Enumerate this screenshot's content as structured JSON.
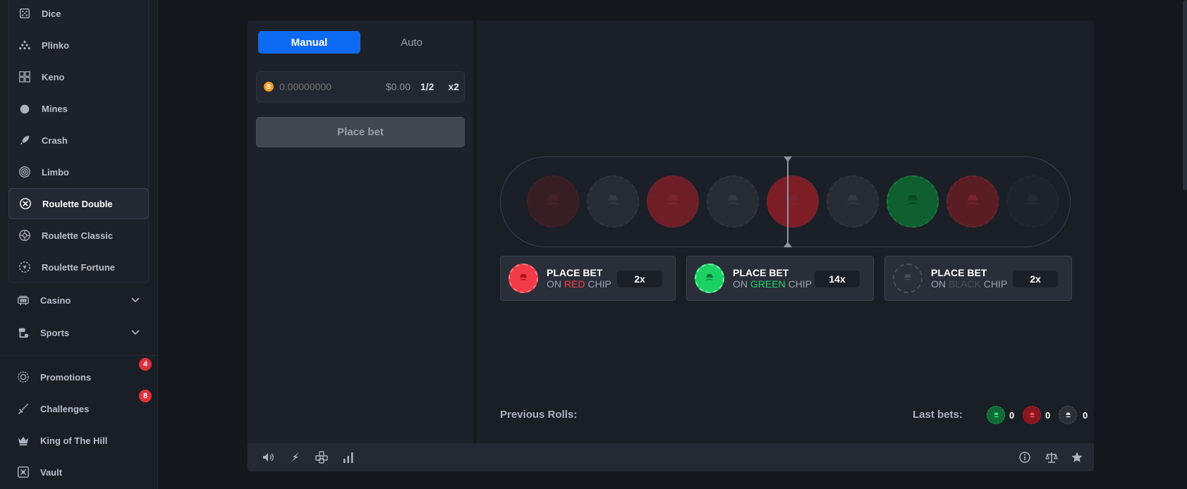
{
  "sidebar": {
    "games": [
      {
        "label": "Dice",
        "icon": "dice-icon"
      },
      {
        "label": "Plinko",
        "icon": "plinko-icon"
      },
      {
        "label": "Keno",
        "icon": "keno-icon"
      },
      {
        "label": "Mines",
        "icon": "mine-icon"
      },
      {
        "label": "Crash",
        "icon": "rocket-icon"
      },
      {
        "label": "Limbo",
        "icon": "target-icon"
      },
      {
        "label": "Roulette Double",
        "icon": "roulette-double-icon",
        "active": true
      },
      {
        "label": "Roulette Classic",
        "icon": "roulette-wheel-icon"
      },
      {
        "label": "Roulette Fortune",
        "icon": "roulette-fortune-icon"
      }
    ],
    "casino_label": "Casino",
    "sports_label": "Sports",
    "extras": [
      {
        "label": "Promotions",
        "icon": "promotions-icon",
        "badge": "4"
      },
      {
        "label": "Challenges",
        "icon": "sword-icon",
        "badge": "8"
      },
      {
        "label": "King of The Hill",
        "icon": "crown-icon"
      },
      {
        "label": "Vault",
        "icon": "vault-icon"
      }
    ]
  },
  "bet_panel": {
    "tab_manual": "Manual",
    "tab_auto": "Auto",
    "coin_symbol": "B",
    "amount_placeholder": "0.00000000",
    "usd_value": "$0.00",
    "half_label": "1/2",
    "double_label": "x2",
    "place_bet_label": "Place bet"
  },
  "wheel": {
    "chips": [
      "red",
      "black",
      "red",
      "black",
      "red",
      "black",
      "green",
      "red",
      "black"
    ]
  },
  "bet_options": [
    {
      "line1": "PLACE BET",
      "prefix": "ON ",
      "color_word": "RED",
      "suffix": " CHIP",
      "multiplier": "2x",
      "color": "#ff3b48"
    },
    {
      "line1": "PLACE BET",
      "prefix": "ON ",
      "color_word": "GREEN",
      "suffix": " CHIP",
      "multiplier": "14x",
      "color": "#1fd86a"
    },
    {
      "line1": "PLACE BET",
      "prefix": "ON ",
      "color_word": "BLACK",
      "suffix": " CHIP",
      "multiplier": "2x",
      "color": "#4a4f5a"
    }
  ],
  "history": {
    "previous_rolls_label": "Previous Rolls:",
    "last_bets_label": "Last bets:",
    "green_count": "0",
    "red_count": "0",
    "black_count": "0"
  },
  "colors": {
    "accent": "#0e6af0",
    "red_chip": "#e8323e",
    "green_chip": "#17c35d",
    "black_chip": "#2a2e36",
    "badge": "#e0303a"
  }
}
